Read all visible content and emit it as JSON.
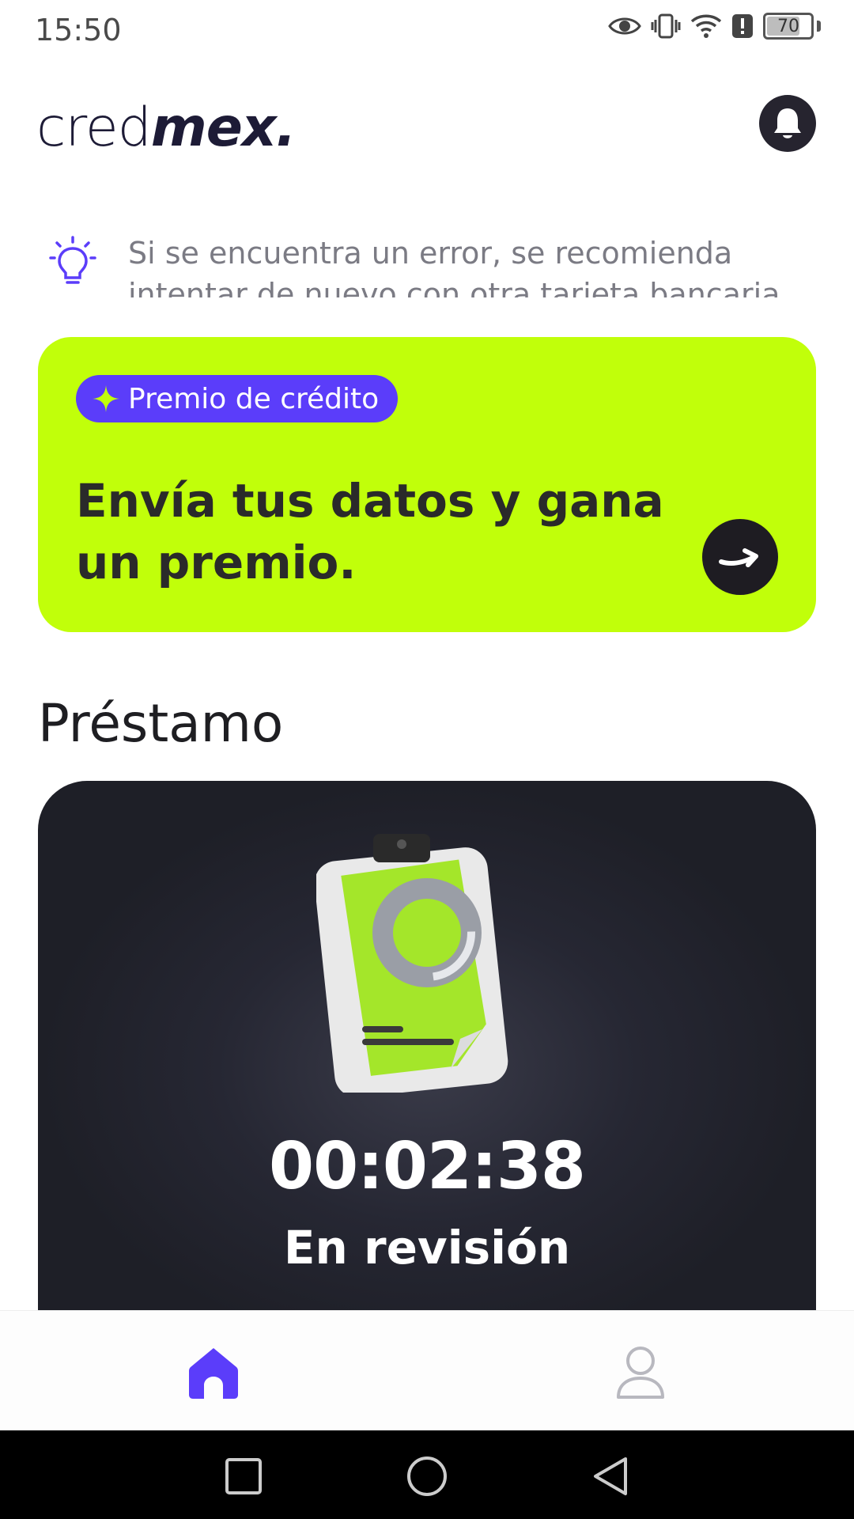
{
  "status_bar": {
    "time": "15:50",
    "battery_level": "70",
    "icons": [
      "eye-icon",
      "vibrate-icon",
      "wifi-icon",
      "alert-icon",
      "battery-icon"
    ]
  },
  "header": {
    "logo_part1": "cred",
    "logo_part2": "mex.",
    "notification_icon": "bell-icon"
  },
  "tip": {
    "icon": "lightbulb-icon",
    "text": "Si se encuentra un error, se recomienda intentar de nuevo con otra tarjeta bancaria"
  },
  "promo": {
    "badge_icon": "sparkle-icon",
    "badge_label": "Premio de crédito",
    "title": "Envía tus datos y gana un premio.",
    "arrow_icon": "arrow-right-icon",
    "background_color": "#c1ff0a",
    "badge_color": "#5b3dfa"
  },
  "loan": {
    "section_title": "Préstamo",
    "timer": "00:02:38",
    "status": "En revisión"
  },
  "bottom_nav": {
    "items": [
      {
        "name": "home",
        "icon": "home-icon",
        "active": true
      },
      {
        "name": "profile",
        "icon": "profile-icon",
        "active": false
      }
    ],
    "active_color": "#5b3dfa"
  },
  "system_nav": [
    "recents-button",
    "home-button",
    "back-button"
  ]
}
